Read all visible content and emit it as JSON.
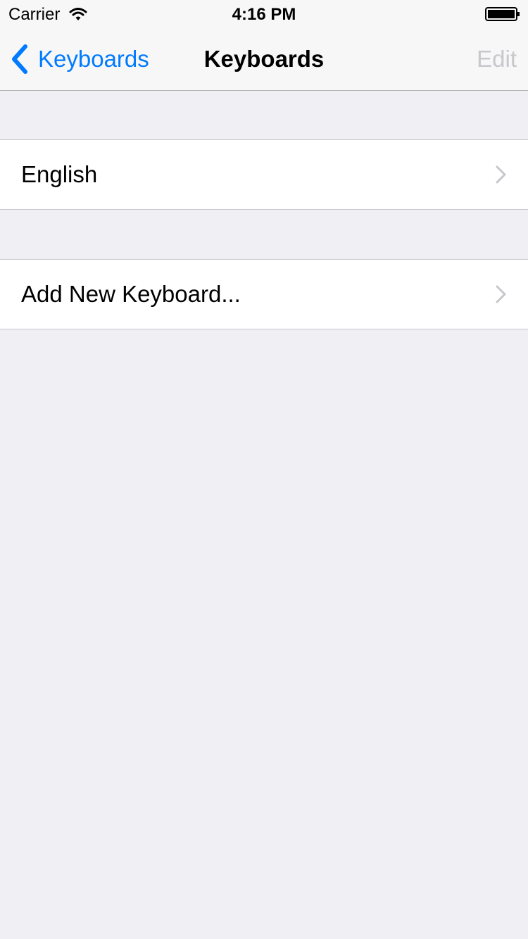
{
  "status_bar": {
    "carrier": "Carrier",
    "time": "4:16 PM",
    "wifi_icon": "wifi-icon",
    "battery_icon": "battery-icon"
  },
  "nav_bar": {
    "back_label": "Keyboards",
    "title": "Keyboards",
    "edit_label": "Edit",
    "accent_color": "#007aff",
    "disabled_color": "#c7c7cc"
  },
  "list": {
    "items": [
      {
        "label": "English",
        "accessory": "chevron-right-icon"
      },
      {
        "label": "Add New Keyboard...",
        "accessory": "chevron-right-icon"
      }
    ]
  },
  "colors": {
    "background": "#efeff4",
    "cell_background": "#ffffff",
    "separator": "#c8c7cc"
  }
}
